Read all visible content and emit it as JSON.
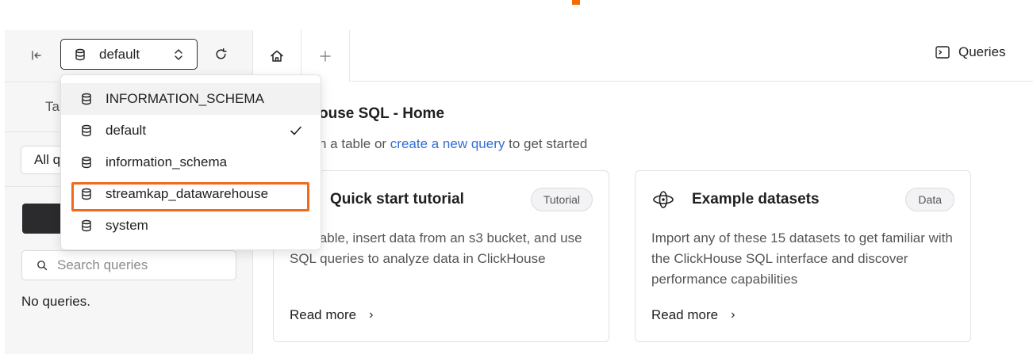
{
  "sidebar": {
    "database_select": {
      "value": "default"
    },
    "tab_label_fragment": "Ta",
    "filter_fragment": "All q",
    "search": {
      "placeholder": "Search queries"
    },
    "empty_text": "No queries."
  },
  "dropdown": {
    "items": [
      {
        "label": "INFORMATION_SCHEMA",
        "selected": false
      },
      {
        "label": "default",
        "selected": true
      },
      {
        "label": "information_schema",
        "selected": false
      },
      {
        "label": "streamkap_datawarehouse",
        "selected": false
      },
      {
        "label": "system",
        "selected": false
      }
    ]
  },
  "header": {
    "queries_label": "Queries"
  },
  "main": {
    "title": "ouse SQL - Home",
    "subtitle_prefix": "n a table or ",
    "subtitle_link": "create a new query",
    "subtitle_suffix": " to get started",
    "cards": [
      {
        "title": "Quick start tutorial",
        "badge": "Tutorial",
        "icon": "tutorial-icon",
        "description": "te a table, insert data from an s3 bucket, and use SQL queries to analyze data in ClickHouse",
        "read_more": "Read more"
      },
      {
        "title": "Example datasets",
        "badge": "Data",
        "icon": "datasets-icon",
        "description": "Import any of these 15 datasets to get familiar with the ClickHouse SQL interface and discover performance capabilities",
        "read_more": "Read more"
      }
    ]
  },
  "colors": {
    "accent": "#f56a00",
    "highlight": "#f06a1c",
    "link": "#2f6fd6",
    "dark_button": "#2b2b2e"
  }
}
